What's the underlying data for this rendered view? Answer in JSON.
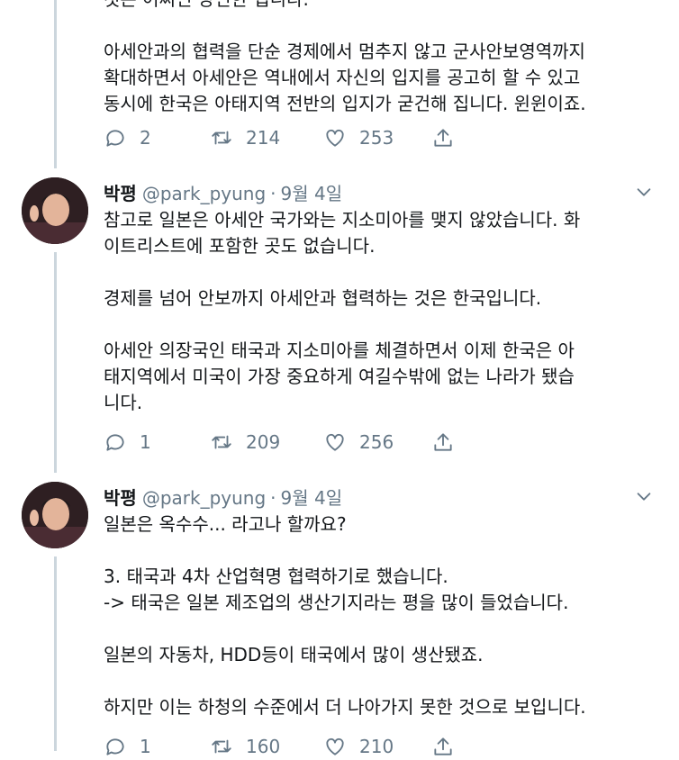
{
  "tweets": [
    {
      "lines": [
        "것은 어쩌면 당연한 겁니다.",
        "",
        "아세안과의 협력을 단순 경제에서 멈추지 않고 군사안보영역까지",
        "확대하면서 아세안은 역내에서 자신의 입지를 공고히 할 수 있고",
        "동시에 한국은 아태지역 전반의 입지가 굳건해 집니다. 윈윈이죠."
      ],
      "replies": "2",
      "retweets": "214",
      "likes": "253"
    },
    {
      "author": "박평",
      "handle": "@park_pyung",
      "separator": "·",
      "date": "9월 4일",
      "lines": [
        "참고로 일본은 아세안 국가와는 지소미아를 맺지 않았습니다. 화",
        "이트리스트에 포함한 곳도 없습니다.",
        "",
        "경제를 넘어 안보까지 아세안과 협력하는 것은 한국입니다.",
        "",
        "아세안 의장국인 태국과 지소미아를 체결하면서 이제 한국은 아",
        "태지역에서 미국이 가장 중요하게 여길수밖에 없는 나라가 됐습",
        "니다."
      ],
      "replies": "1",
      "retweets": "209",
      "likes": "256"
    },
    {
      "author": "박평",
      "handle": "@park_pyung",
      "separator": "·",
      "date": "9월 4일",
      "lines": [
        "일본은 옥수수... 라고나 할까요?",
        "",
        "3. 태국과 4차 산업혁명 협력하기로 했습니다.",
        "-> 태국은 일본 제조업의 생산기지라는 평을 많이 들었습니다.",
        "",
        "일본의 자동차, HDD등이 태국에서 많이 생산됐죠.",
        "",
        "하지만 이는 하청의 수준에서 더 나아가지 못한 것으로 보입니다."
      ],
      "replies": "1",
      "retweets": "160",
      "likes": "210"
    }
  ],
  "icons": {
    "reply": "reply-icon",
    "retweet": "retweet-icon",
    "like": "like-icon",
    "share": "share-icon",
    "more": "chevron-down-icon"
  },
  "colors": {
    "text": "#14171a",
    "muted": "#657786",
    "thread_line": "#ccd6dd"
  }
}
